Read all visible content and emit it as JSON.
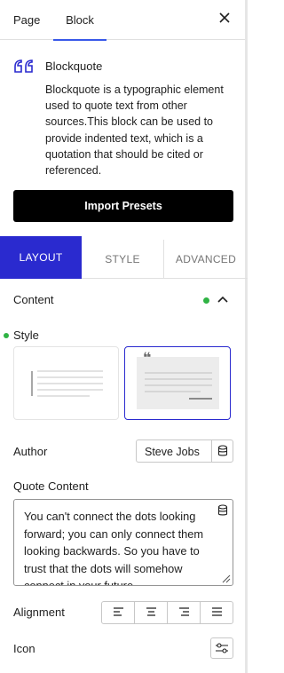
{
  "tabs": {
    "page": "Page",
    "block": "Block",
    "active": "Block"
  },
  "block": {
    "title": "Blockquote",
    "description": "Blockquote is a typographic element used to quote text from other sources.This block can be used to provide indented text, which is a quotation that should be cited or referenced."
  },
  "import_button": "Import Presets",
  "subtabs": {
    "layout": "LAYOUT",
    "style": "STYLE",
    "advanced": "ADVANCED",
    "active": "LAYOUT"
  },
  "content_section": {
    "title": "Content",
    "expanded": true
  },
  "style_section": {
    "label": "Style",
    "selected_preset": 2
  },
  "author": {
    "label": "Author",
    "value": "Steve Jobs"
  },
  "quote": {
    "label": "Quote Content",
    "value": "You can't connect the dots looking forward; you can only connect them looking backwards. So you have to trust that the dots will somehow connect in your future."
  },
  "alignment": {
    "label": "Alignment",
    "options": [
      "align-left",
      "align-center",
      "align-right",
      "justify"
    ]
  },
  "icon_row": {
    "label": "Icon"
  },
  "colors": {
    "accent": "#2a2acf",
    "indicator": "#2fb344",
    "primary_button": "#000000",
    "quote_icon": "#2a2acf"
  }
}
